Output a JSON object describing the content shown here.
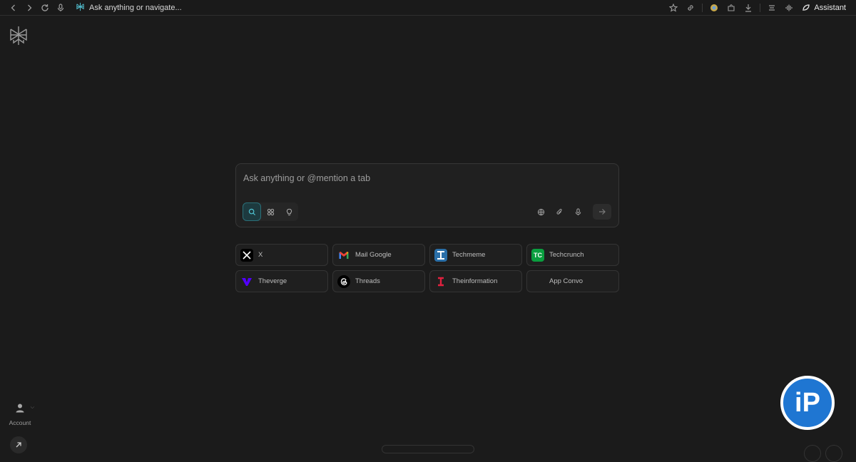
{
  "browser": {
    "address_text": "Ask anything or navigate...",
    "assistant_label": "Assistant"
  },
  "composer": {
    "placeholder": "Ask anything or @mention a tab",
    "modes": [
      "search",
      "research",
      "labs"
    ],
    "active_mode": "search"
  },
  "shortcuts": [
    {
      "label": "X",
      "icon": "x-icon",
      "color": "#000000"
    },
    {
      "label": "Mail Google",
      "icon": "gmail-icon",
      "color": "#ffffff"
    },
    {
      "label": "Techmeme",
      "icon": "techmeme-icon",
      "color": "#2a6fa8"
    },
    {
      "label": "Techcrunch",
      "icon": "techcrunch-icon",
      "color": "#0a9e3f"
    },
    {
      "label": "Theverge",
      "icon": "verge-icon",
      "color": "#5200ff"
    },
    {
      "label": "Threads",
      "icon": "threads-icon",
      "color": "#000000"
    },
    {
      "label": "Theinformation",
      "icon": "theinformation-icon",
      "color": "#e2213f"
    },
    {
      "label": "App Convo",
      "icon": "",
      "color": ""
    }
  ],
  "sidebar": {
    "account_label": "Account"
  },
  "watermark": {
    "text": "iP"
  }
}
